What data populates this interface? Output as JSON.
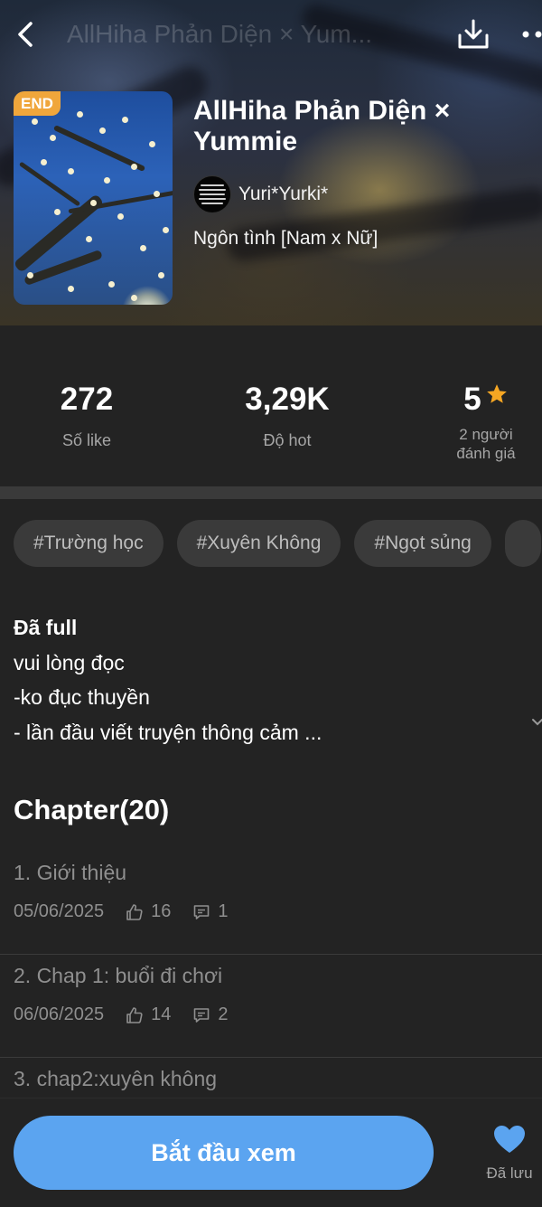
{
  "header": {
    "faded_title": "AllHiha Phản Diện × Yum...",
    "back_icon": "chevron-left-icon",
    "download_icon": "download-icon",
    "more_icon": "more-dots-icon"
  },
  "book": {
    "badge": "END",
    "title": "AllHiha Phản Diện × Yummie",
    "author": "Yuri*Yurki*",
    "genre": "Ngôn tình [Nam x Nữ]"
  },
  "stats": {
    "likes": {
      "value": "272",
      "label": "Số like"
    },
    "hot": {
      "value": "3,29K",
      "label": "Độ hot"
    },
    "rating": {
      "value": "5",
      "label_line1": "2 người",
      "label_line2": "đánh giá",
      "star_color": "#f5a623"
    }
  },
  "tags": [
    "#Trường học",
    "#Xuyên Không",
    "#Ngọt sủng"
  ],
  "description": {
    "lines": [
      "Đã full",
      "vui lòng đọc",
      "-ko đục thuyền",
      "- lần đầu viết truyện thông cảm ..."
    ]
  },
  "chapters": {
    "heading": "Chapter(20)",
    "items": [
      {
        "title": "1. Giới thiệu",
        "date": "05/06/2025",
        "likes": "16",
        "comments": "1"
      },
      {
        "title": "2. Chap 1: buổi đi chơi",
        "date": "06/06/2025",
        "likes": "14",
        "comments": "2"
      },
      {
        "title": "3. chap2:xuyên không",
        "date": "",
        "likes": "",
        "comments": ""
      }
    ]
  },
  "bottom": {
    "start_label": "Bắt đầu xem",
    "saved_label": "Đã lưu",
    "accent": "#5ba4f0"
  }
}
